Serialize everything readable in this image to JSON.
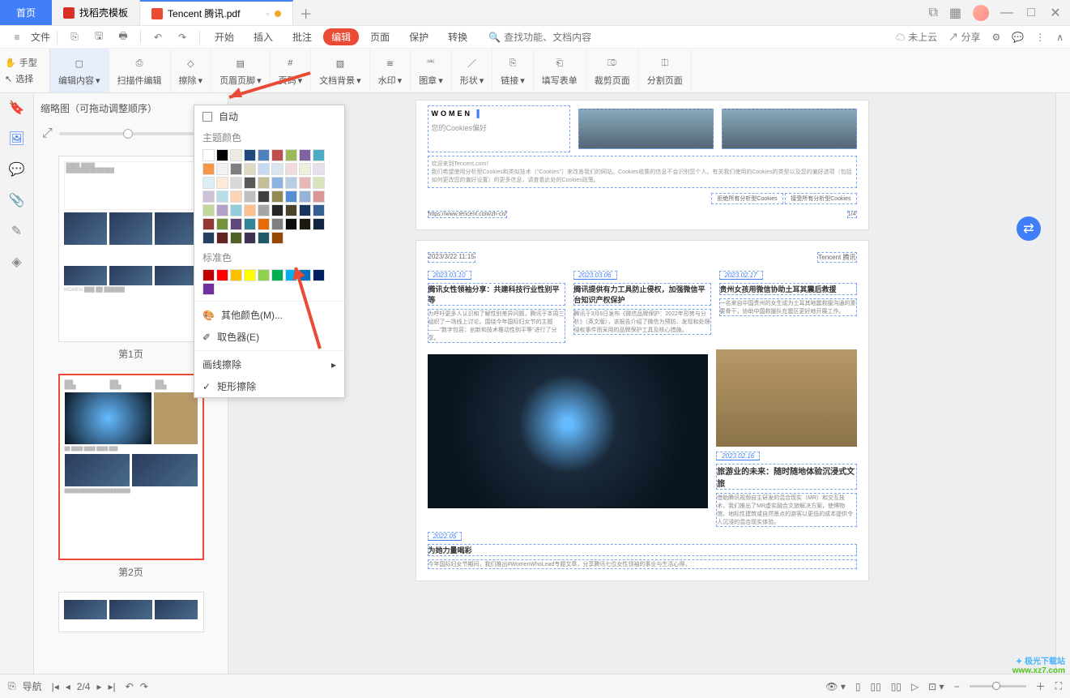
{
  "tabs": {
    "home": "首页",
    "t1": "找稻壳模板",
    "t2": "Tencent 腾讯.pdf"
  },
  "menubar": {
    "file": "文件",
    "items": [
      "开始",
      "插入",
      "批注",
      "编辑",
      "页面",
      "保护",
      "转换"
    ],
    "active_index": 3,
    "search_placeholder": "查找功能、文档内容",
    "cloud": "未上云",
    "share": "分享"
  },
  "toolbox_left": {
    "hand": "手型",
    "select": "选择"
  },
  "ribbon": {
    "edit_content": "编辑内容",
    "scan_edit": "扫描件编辑",
    "erase": "擦除",
    "header_footer": "页眉页脚",
    "page_num": "页码",
    "doc_bg": "文档背景",
    "watermark": "水印",
    "stamp": "图章",
    "shape": "形状",
    "link": "链接",
    "form": "填写表单",
    "crop": "裁剪页面",
    "split": "分割页面"
  },
  "thumbs": {
    "title": "缩略图（可拖动调整顺序）",
    "p1": "第1页",
    "p2": "第2页"
  },
  "dropdown": {
    "auto": "自动",
    "theme": "主题颜色",
    "standard": "标准色",
    "theme_colors": [
      "#ffffff",
      "#000000",
      "#eeece1",
      "#1f497d",
      "#4f81bd",
      "#c0504d",
      "#9bbb59",
      "#8064a2",
      "#4bacc6",
      "#f79646",
      "#f2f2f2",
      "#7f7f7f",
      "#ddd9c3",
      "#c6d9f0",
      "#dbe5f1",
      "#f2dcdb",
      "#ebf1dd",
      "#e5e0ec",
      "#dbeef3",
      "#fdeada",
      "#d8d8d8",
      "#595959",
      "#c4bd97",
      "#8db3e2",
      "#b8cce4",
      "#e5b9b7",
      "#d7e3bc",
      "#ccc1d9",
      "#b7dde8",
      "#fbd5b5",
      "#bfbfbf",
      "#3f3f3f",
      "#938953",
      "#548dd4",
      "#95b3d7",
      "#d99694",
      "#c3d69b",
      "#b2a2c7",
      "#92cddc",
      "#fac08f",
      "#a5a5a5",
      "#262626",
      "#494429",
      "#17365d",
      "#366092",
      "#953734",
      "#76923c",
      "#5f497a",
      "#31859b",
      "#e36c09",
      "#7f7f7f",
      "#0c0c0c",
      "#1d1b10",
      "#0f243e",
      "#244061",
      "#632423",
      "#4f6128",
      "#3f3151",
      "#205867",
      "#974806"
    ],
    "standard_colors": [
      "#c00000",
      "#ff0000",
      "#ffc000",
      "#ffff00",
      "#92d050",
      "#00b050",
      "#00b0f0",
      "#0070c0",
      "#002060",
      "#7030a0"
    ],
    "more": "其他颜色(M)...",
    "picker": "取色器(E)",
    "line_erase": "画线擦除",
    "rect_erase": "矩形擦除"
  },
  "doc": {
    "page1": {
      "women": "WOMEN",
      "cookie_title": "您的Cookies偏好",
      "cookie_welcome": "欢迎来到Tencent.com！",
      "cookie_desc": "我们希望使用分析型Cookies和类似技术（\"Cookies\"）来改善我们的网站。Cookies收集的信息不会识别您个人。有关我们使用的Cookies的类型以及您的偏好选项（包括如何更改您的偏好设置）的更多信息，请查看此处的Cookies政策。",
      "reject": "拒绝所有分析型Cookies",
      "accept": "接受所有分析型Cookies",
      "url": "https://www.tencent.com/zh-cn/",
      "page_ind": "1/4"
    },
    "page2": {
      "ts": "2023/3/22 11:15",
      "brand": "Tencent 腾讯",
      "d1": "2023.03.10",
      "d2": "2023.03.06",
      "d3": "2023.02.17",
      "h1": "腾讯女性领袖分享：共建科技行业性别平等",
      "t1": "为呼吁更多人认识和了解性别差异问题，腾讯于本周三组织了一场线上讨论。围绕今年国际妇女节的主题——\"数字包容：创新和技术推动性别平等\"进行了分享。",
      "h2": "腾讯提供有力工具防止侵权，加强微信平台知识产权保护",
      "t2": "腾讯于3月6日发布《微信品牌保护：2022年形势与分析》（英文版），该报告介绍了微信为预防、发现和处理侵权事件而采用的品牌保护工具及核心措施。",
      "h3": "贵州女孩用微信协助土耳其震后救援",
      "t3": "一名来自中国贵州的女生成为土耳其地震救援沟通的重要骨干，协助中国救援队在震区更好地开展工作。",
      "d4": "2022.05",
      "h4": "为她力量喝彩",
      "t4": "今年国际妇女节期间，我们推出#WomenWhoLead专题文章，分享腾讯七位女性领袖的事业与生活心得。",
      "d5": "2023.02.16",
      "h5": "旅游业的未来：随时随地体验沉浸式文旅",
      "t5": "借助腾讯视频自主研发的混合现实（MR）和交互技术，我们推出了MR虚实融合文旅解决方案，使博物馆、地标性建筑或自然景点的游客以更低的成本提供令人沉浸的混合现实体验。"
    }
  },
  "status": {
    "nav": "导航",
    "page": "2/4"
  },
  "watermark": {
    "l1": "极光下载站",
    "l2": "www.xz7.com"
  }
}
